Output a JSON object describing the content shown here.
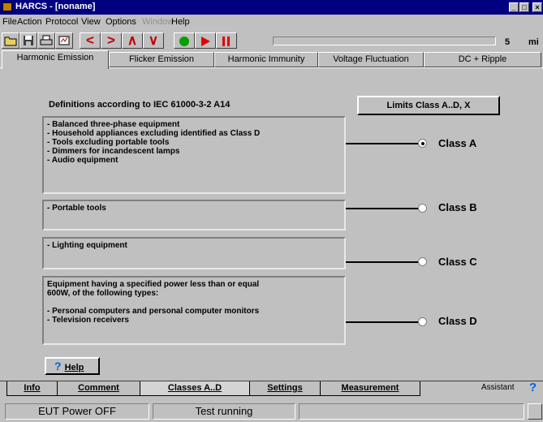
{
  "window": {
    "title": "HARCS - [noname]"
  },
  "menu": [
    {
      "label": "File",
      "disabled": false
    },
    {
      "label": "Action",
      "disabled": false
    },
    {
      "label": "Protocol",
      "disabled": false
    },
    {
      "label": "View",
      "disabled": false
    },
    {
      "label": "Options",
      "disabled": false
    },
    {
      "label": "Window",
      "disabled": true
    },
    {
      "label": "Help",
      "disabled": false
    }
  ],
  "toolbar": {
    "timer_value": "5",
    "timer_unit": "mi"
  },
  "tabs_top": [
    "Harmonic Emission",
    "Flicker Emission",
    "Harmonic Immunity",
    "Voltage Fluctuation",
    "DC + Ripple"
  ],
  "main": {
    "heading": "Definitions according to IEC 61000-3-2 A14",
    "limits_button": "Limits Class A..D, X",
    "groups": [
      {
        "lines": [
          "- Balanced three-phase equipment",
          "- Household appliances excluding identified as Class D",
          "- Tools excluding portable tools",
          "- Dimmers for incandescent lamps",
          "- Audio equipment"
        ],
        "label": "Class A",
        "selected": true
      },
      {
        "lines": [
          "- Portable  tools"
        ],
        "label": "Class B",
        "selected": false
      },
      {
        "lines": [
          "- Lighting equipment"
        ],
        "label": "Class C",
        "selected": false
      },
      {
        "lines": [
          "Equipment having a specified power less than or equal",
          "600W, of the following types:",
          "",
          "- Personal computers and personal computer monitors",
          "- Television receivers"
        ],
        "label": "Class D",
        "selected": false
      }
    ],
    "help_button": "Help"
  },
  "tabs_bottom": [
    "Info",
    "Comment",
    "Classes A..D",
    "Settings",
    "Measurement"
  ],
  "assistant_label": "Assistant",
  "status": {
    "pane1": "EUT Power OFF",
    "pane2": "Test running",
    "pane3": ""
  },
  "colors": {
    "titlebar": "#000080",
    "face": "#c0c0c0",
    "record": "#00a000",
    "play": "#e00000",
    "pause": "#e00000",
    "nav": "#c00000",
    "help": "#0060e0"
  }
}
